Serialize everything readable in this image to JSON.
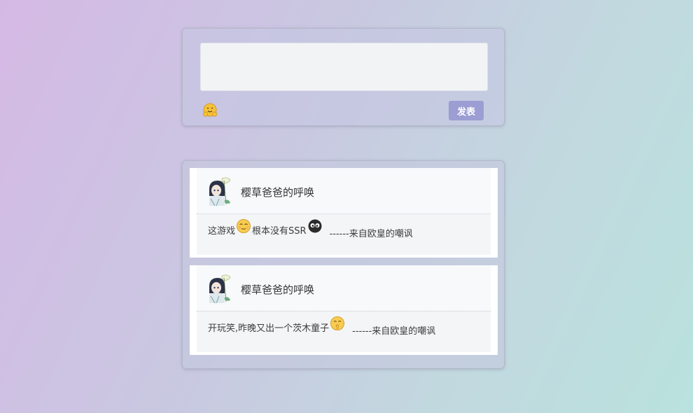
{
  "composer": {
    "input_value": "",
    "emoji_button_icon": "hugging-face-icon",
    "post_button_label": "发表"
  },
  "feed": {
    "posts": [
      {
        "username": "樱草爸爸的呼唤",
        "avatar_icon": "anime-character-avatar",
        "text_before": "这游戏",
        "emoji_1": "relieved-face-icon",
        "text_middle": "根本没有SSR",
        "emoji_2": "black-ball-eyes-icon",
        "signature": "------来自欧皇的嘲讽"
      },
      {
        "username": "樱草爸爸的呼唤",
        "avatar_icon": "anime-character-avatar",
        "text_before": "开玩笑,昨晚又出一个茨木童子",
        "emoji_1": "shushing-face-icon",
        "signature": "------来自欧皇的嘲讽"
      }
    ]
  },
  "colors": {
    "post_button": "#9b9dd3",
    "background_start": "#d5b9e5",
    "background_end": "#b9e2de"
  }
}
